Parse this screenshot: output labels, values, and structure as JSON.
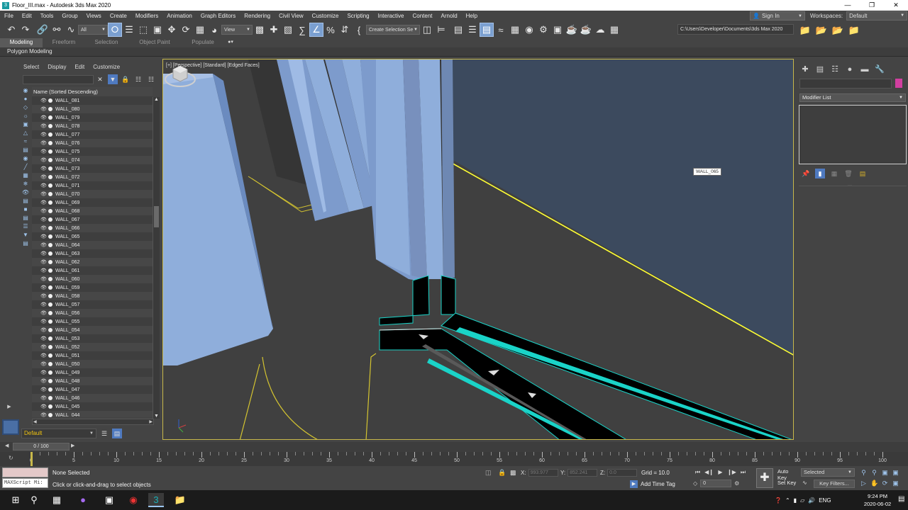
{
  "window": {
    "title": "Floor_III.max - Autodesk 3ds Max 2020",
    "app_icon": "3"
  },
  "menu": [
    "File",
    "Edit",
    "Tools",
    "Group",
    "Views",
    "Create",
    "Modifiers",
    "Animation",
    "Graph Editors",
    "Rendering",
    "Civil View",
    "Customize",
    "Scripting",
    "Interactive",
    "Content",
    "Arnold",
    "Help"
  ],
  "signin": "Sign In",
  "workspaces": {
    "label": "Workspaces:",
    "value": "Default"
  },
  "toolbar": {
    "filter": "All",
    "refcoord": "View",
    "selection_set": "Create Selection Se",
    "project_path": "C:\\Users\\Developer\\Documents\\3ds Max 2020"
  },
  "ribbon": {
    "tabs": [
      "Modeling",
      "Freeform",
      "Selection",
      "Object Paint",
      "Populate"
    ],
    "active_tab": "Modeling",
    "panel_label": "Polygon Modeling"
  },
  "explorer": {
    "menu": [
      "Select",
      "Display",
      "Edit",
      "Customize"
    ],
    "column_header": "Name (Sorted Descending)",
    "items": [
      "WALL_081",
      "WALL_080",
      "WALL_079",
      "WALL_078",
      "WALL_077",
      "WALL_076",
      "WALL_075",
      "WALL_074",
      "WALL_073",
      "WALL_072",
      "WALL_071",
      "WALL_070",
      "WALL_069",
      "WALL_068",
      "WALL_067",
      "WALL_066",
      "WALL_065",
      "WALL_064",
      "WALL_063",
      "WALL_062",
      "WALL_061",
      "WALL_060",
      "WALL_059",
      "WALL_058",
      "WALL_057",
      "WALL_056",
      "WALL_055",
      "WALL_054",
      "WALL_053",
      "WALL_052",
      "WALL_051",
      "WALL_050",
      "WALL_049",
      "WALL_048",
      "WALL_047",
      "WALL_046",
      "WALL_045",
      "WALL_044"
    ],
    "layer": "Default"
  },
  "viewport": {
    "label": "[+] [Perspective] [Standard] [Edged Faces]",
    "tooltip": "WALL_065",
    "colors": {
      "wall": "#8faedb",
      "wall_dark": "#5c7aa6",
      "floor": "#404040",
      "backwall": "#3c4a5e",
      "highlight": "#ffff33",
      "trim": "#1ad3c8"
    }
  },
  "command_panel": {
    "modifier_list": "Modifier List",
    "object_color": "#d23fa0"
  },
  "timeline": {
    "frame_display": "0 / 100",
    "ticks": [
      0,
      5,
      10,
      15,
      20,
      25,
      30,
      35,
      40,
      45,
      50,
      55,
      60,
      65,
      70,
      75,
      80,
      85,
      90,
      95,
      100
    ]
  },
  "status": {
    "maxscript": "MAXScript Mi:",
    "selection": "None Selected",
    "prompt": "Click or click-and-drag to select objects",
    "x_label": "X:",
    "x_value": "993.977",
    "y_label": "Y:",
    "y_value": "852.241",
    "z_label": "Z:",
    "z_value": "0.0",
    "grid": "Grid = 10.0",
    "add_time_tag": "Add Time Tag",
    "frame": "0",
    "auto_key": "Auto Key",
    "set_key": "Set Key",
    "key_mode": "Selected",
    "key_filters": "Key Filters..."
  },
  "taskbar": {
    "language": "ENG",
    "time": "9:24 PM",
    "date": "2020-06-02"
  }
}
